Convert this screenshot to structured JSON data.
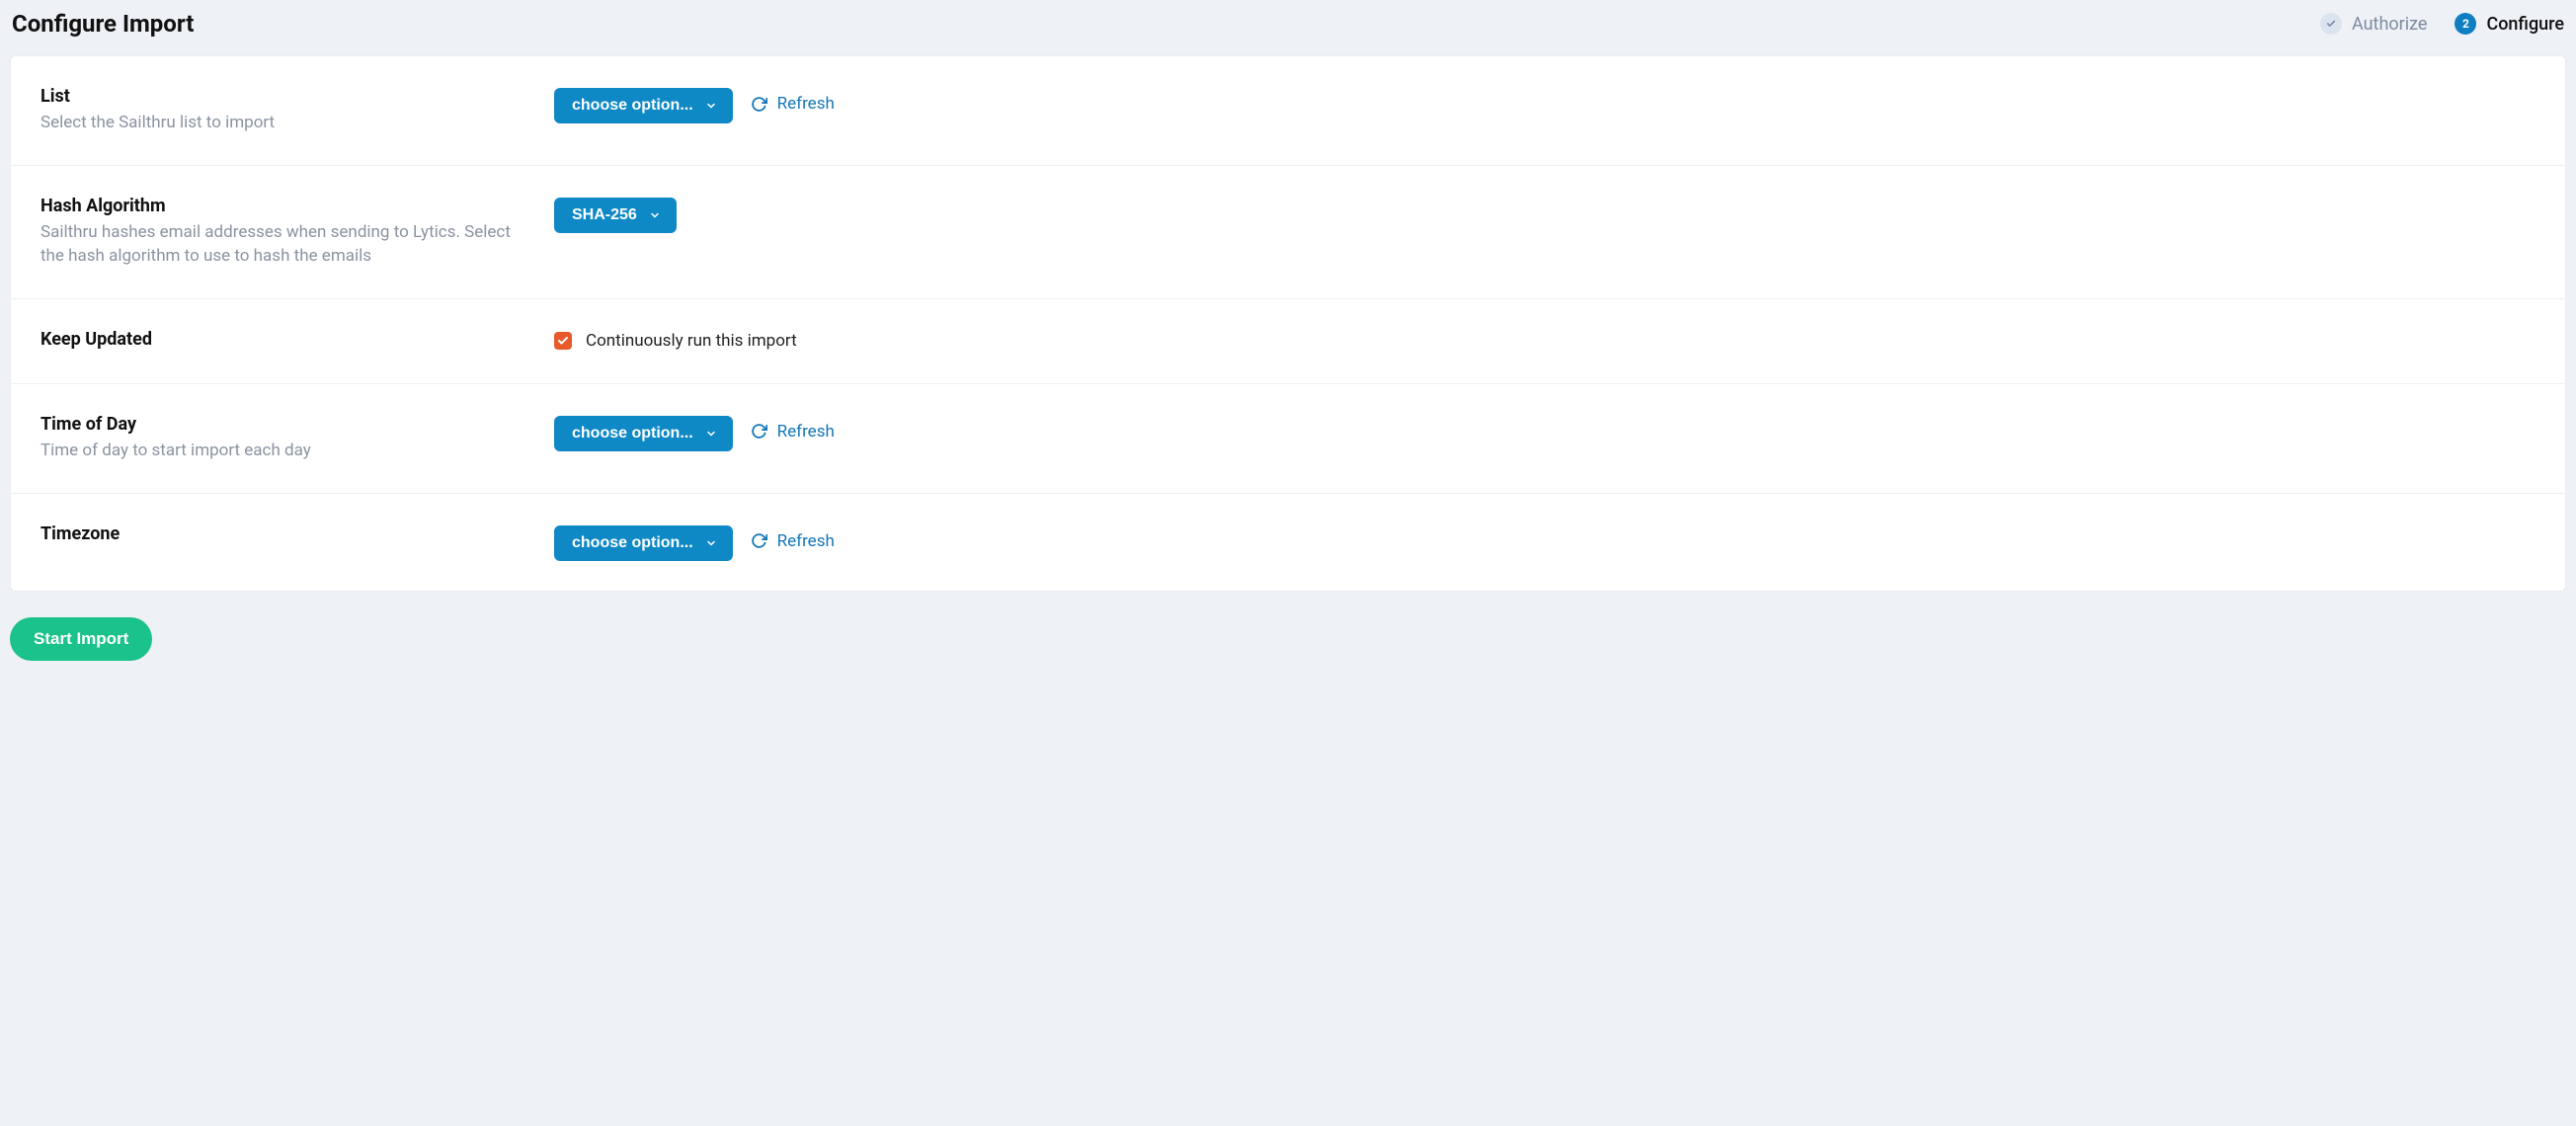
{
  "header": {
    "title": "Configure Import"
  },
  "stepper": {
    "step1": {
      "icon": "check",
      "label": "Authorize"
    },
    "step2": {
      "num": "2",
      "label": "Configure"
    }
  },
  "rows": {
    "list": {
      "title": "List",
      "desc": "Select the Sailthru list to import",
      "select": "choose option...",
      "refresh": "Refresh"
    },
    "hash": {
      "title": "Hash Algorithm",
      "desc": "Sailthru hashes email addresses when sending to Lytics. Select the hash algorithm to use to hash the emails",
      "select": "SHA-256"
    },
    "keep": {
      "title": "Keep Updated",
      "checkbox_label": "Continuously run this import"
    },
    "tod": {
      "title": "Time of Day",
      "desc": "Time of day to start import each day",
      "select": "choose option...",
      "refresh": "Refresh"
    },
    "tz": {
      "title": "Timezone",
      "select": "choose option...",
      "refresh": "Refresh"
    }
  },
  "footer": {
    "start": "Start Import"
  }
}
